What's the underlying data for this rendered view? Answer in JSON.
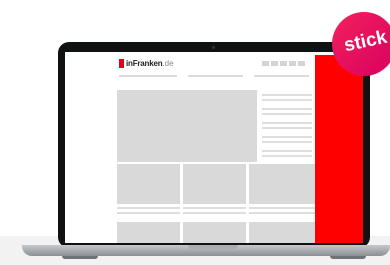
{
  "badge": {
    "label": "stick",
    "color": "#e6005f"
  },
  "site": {
    "logo_name": "inFranken",
    "logo_tld": ".de",
    "brand_color": "#e2001a"
  },
  "ad": {
    "color": "#ff0000"
  }
}
